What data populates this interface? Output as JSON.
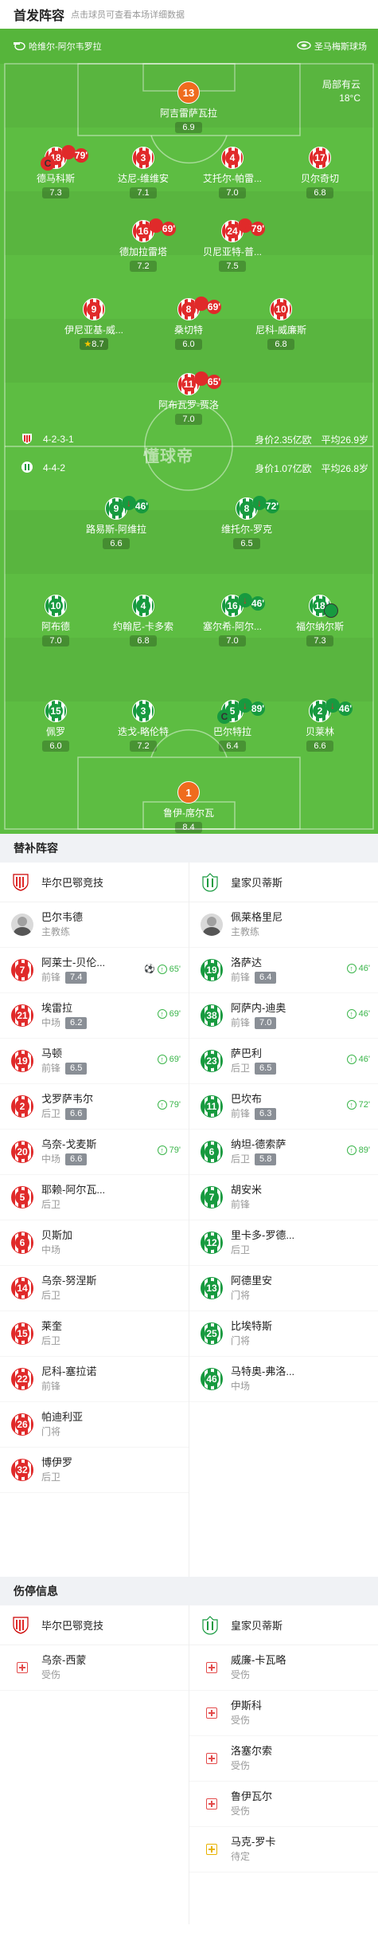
{
  "header": {
    "title": "首发阵容",
    "subtitle": "点击球员可查看本场详细数据"
  },
  "pitch": {
    "home_venue_label": "哈维尔-阿尔韦罗拉",
    "away_venue_label": "圣马梅斯球场",
    "weather": "局部有云",
    "temperature": "18°C",
    "watermark": "懂球帝",
    "home_team": {
      "formation": "4-2-3-1",
      "value": "身价2.35亿欧",
      "age": "平均26.9岁"
    },
    "away_team": {
      "formation": "4-4-2",
      "value": "身价1.07亿欧",
      "age": "平均26.8岁"
    }
  },
  "home_lineup": [
    {
      "num": "13",
      "name": "阿吉雷萨瓦拉",
      "rating": "6.9",
      "gk": true
    },
    {
      "num": "18",
      "name": "德马科斯",
      "rating": "7.3",
      "sub": "79'",
      "captain": true
    },
    {
      "num": "3",
      "name": "达尼-维维安",
      "rating": "7.1"
    },
    {
      "num": "4",
      "name": "艾托尔-帕雷...",
      "rating": "7.0"
    },
    {
      "num": "17",
      "name": "贝尔奇切",
      "rating": "6.8"
    },
    {
      "num": "16",
      "name": "德加拉雷塔",
      "rating": "7.2",
      "sub": "69'"
    },
    {
      "num": "24",
      "name": "贝尼亚特-普...",
      "rating": "7.5",
      "sub": "79'"
    },
    {
      "num": "9",
      "name": "伊尼亚基-威...",
      "rating": "8.7",
      "star": true
    },
    {
      "num": "8",
      "name": "桑切特",
      "rating": "6.0",
      "sub": "69'"
    },
    {
      "num": "10",
      "name": "尼科-威廉斯",
      "rating": "6.8"
    },
    {
      "num": "11",
      "name": "阿布瓦罗-贾洛",
      "rating": "7.0",
      "sub": "65'"
    }
  ],
  "away_lineup": [
    {
      "num": "9",
      "name": "路易斯-阿维拉",
      "rating": "6.6",
      "sub": "46'"
    },
    {
      "num": "8",
      "name": "维托尔-罗克",
      "rating": "6.5",
      "sub": "72'"
    },
    {
      "num": "10",
      "name": "阿布德",
      "rating": "7.0"
    },
    {
      "num": "4",
      "name": "约翰尼-卡多索",
      "rating": "6.8"
    },
    {
      "num": "16",
      "name": "塞尔希-阿尔...",
      "rating": "7.0",
      "sub": "46'"
    },
    {
      "num": "18",
      "name": "福尔纳尔斯",
      "rating": "7.3",
      "ball": true
    },
    {
      "num": "15",
      "name": "佩罗",
      "rating": "6.0"
    },
    {
      "num": "3",
      "name": "迭戈-略伦特",
      "rating": "7.2"
    },
    {
      "num": "5",
      "name": "巴尔特拉",
      "rating": "6.4",
      "sub": "89'",
      "captain": true
    },
    {
      "num": "2",
      "name": "贝莱林",
      "rating": "6.6",
      "sub": "46'"
    },
    {
      "num": "1",
      "name": "鲁伊-席尔瓦",
      "rating": "8.4",
      "gk": true
    }
  ],
  "subs_section": {
    "title": "替补阵容",
    "home_team_name": "毕尔巴鄂竞技",
    "away_team_name": "皇家贝蒂斯",
    "home_coach": {
      "name": "巴尔韦德",
      "role": "主教练"
    },
    "away_coach": {
      "name": "佩莱格里尼",
      "role": "主教练"
    },
    "home": [
      {
        "num": "7",
        "name": "阿莱士-贝伦...",
        "pos": "前锋",
        "rating": "7.4",
        "event": "65'",
        "goal": true
      },
      {
        "num": "21",
        "name": "埃雷拉",
        "pos": "中场",
        "rating": "6.2",
        "event": "69'"
      },
      {
        "num": "19",
        "name": "马顿",
        "pos": "前锋",
        "rating": "6.5",
        "event": "69'"
      },
      {
        "num": "2",
        "name": "戈罗萨韦尔",
        "pos": "后卫",
        "rating": "6.6",
        "event": "79'"
      },
      {
        "num": "20",
        "name": "乌奈-戈麦斯",
        "pos": "中场",
        "rating": "6.6",
        "event": "79'"
      },
      {
        "num": "5",
        "name": "耶赖-阿尔瓦...",
        "pos": "后卫"
      },
      {
        "num": "6",
        "name": "贝斯加",
        "pos": "中场"
      },
      {
        "num": "14",
        "name": "乌奈-努涅斯",
        "pos": "后卫"
      },
      {
        "num": "15",
        "name": "莱奎",
        "pos": "后卫"
      },
      {
        "num": "22",
        "name": "尼科-塞拉诺",
        "pos": "前锋"
      },
      {
        "num": "26",
        "name": "帕迪利亚",
        "pos": "门将"
      },
      {
        "num": "32",
        "name": "博伊罗",
        "pos": "后卫"
      }
    ],
    "away": [
      {
        "num": "19",
        "name": "洛萨达",
        "pos": "前锋",
        "rating": "6.4",
        "event": "46'"
      },
      {
        "num": "38",
        "name": "阿萨内-迪奥",
        "pos": "前锋",
        "rating": "7.0",
        "event": "46'"
      },
      {
        "num": "23",
        "name": "萨巴利",
        "pos": "后卫",
        "rating": "6.5",
        "event": "46'"
      },
      {
        "num": "11",
        "name": "巴坎布",
        "pos": "前锋",
        "rating": "6.3",
        "event": "72'"
      },
      {
        "num": "6",
        "name": "纳坦-德索萨",
        "pos": "后卫",
        "rating": "5.8",
        "event": "89'"
      },
      {
        "num": "7",
        "name": "胡安米",
        "pos": "前锋"
      },
      {
        "num": "12",
        "name": "里卡多-罗德...",
        "pos": "后卫"
      },
      {
        "num": "13",
        "name": "阿德里安",
        "pos": "门将"
      },
      {
        "num": "25",
        "name": "比埃特斯",
        "pos": "门将"
      },
      {
        "num": "46",
        "name": "马特奥-弗洛...",
        "pos": "中场"
      }
    ]
  },
  "injury_section": {
    "title": "伤停信息",
    "home_team_name": "毕尔巴鄂竞技",
    "away_team_name": "皇家贝蒂斯",
    "home": [
      {
        "name": "乌奈-西蒙",
        "status": "受伤"
      }
    ],
    "away": [
      {
        "name": "威廉-卡瓦略",
        "status": "受伤"
      },
      {
        "name": "伊斯科",
        "status": "受伤"
      },
      {
        "name": "洛塞尔索",
        "status": "受伤"
      },
      {
        "name": "鲁伊瓦尔",
        "status": "受伤"
      },
      {
        "name": "马克-罗卡",
        "status": "待定",
        "questionable": true
      }
    ]
  },
  "colors": {
    "pitch": "#5dbd42",
    "home": "#e02a2a",
    "away": "#179a3f",
    "gk": "#ef6b1e"
  }
}
